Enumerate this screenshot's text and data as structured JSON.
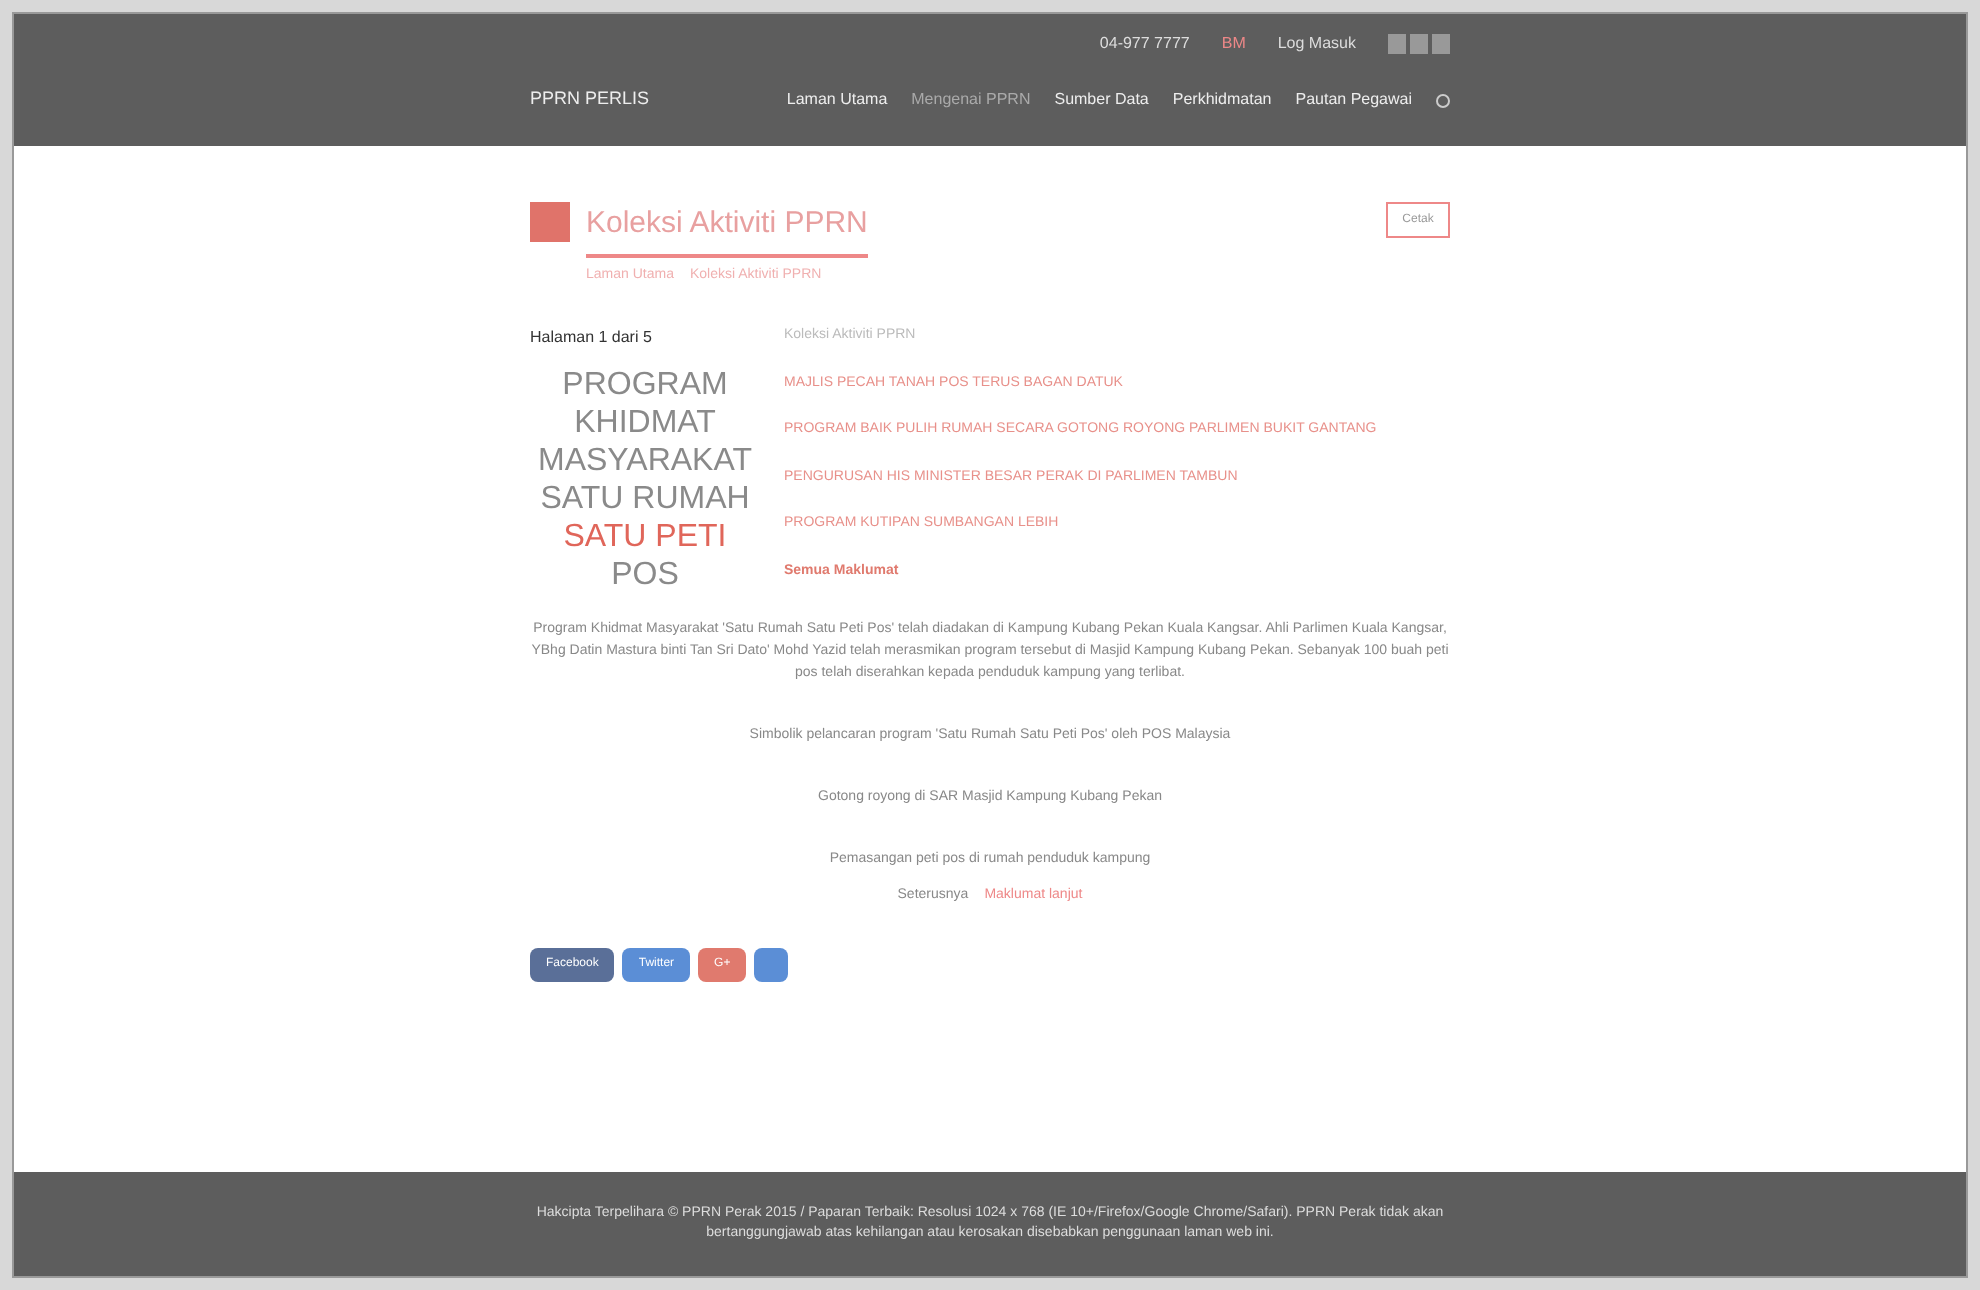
{
  "top_bar": {
    "phone": "04-977 7777",
    "language": "BM",
    "login": "Log Masuk"
  },
  "nav": {
    "brand": "PPRN PERLIS",
    "items": [
      {
        "label": "Laman Utama",
        "selected": false
      },
      {
        "label": "Mengenai PPRN",
        "selected": true
      },
      {
        "label": "Sumber Data",
        "selected": false
      },
      {
        "label": "Perkhidmatan",
        "selected": false
      },
      {
        "label": "Pautan Pegawai",
        "selected": false
      }
    ]
  },
  "page": {
    "title": "Koleksi Aktiviti PPRN",
    "breadcrumb": [
      "Laman Utama",
      "Koleksi Aktiviti PPRN"
    ],
    "print": "Cetak",
    "page_info": "Halaman 1 dari 5"
  },
  "poster_lines": [
    {
      "text": "PROGRAM",
      "kind": "normal"
    },
    {
      "text": "KHIDMAT",
      "kind": "normal"
    },
    {
      "text": "MASYARAKAT",
      "kind": "normal"
    },
    {
      "text": "SATU RUMAH",
      "kind": "normal"
    },
    {
      "text": "SATU PETI",
      "kind": "accent"
    },
    {
      "text": "POS",
      "kind": "normal"
    }
  ],
  "related": {
    "heading": "Koleksi Aktiviti PPRN",
    "links": [
      {
        "text": "MAJLIS PECAH TANAH POS TERUS BAGAN DATUK",
        "kind": "link"
      },
      {
        "text": "PROGRAM BAIK PULIH RUMAH SECARA GOTONG ROYONG PARLIMEN BUKIT GANTANG",
        "kind": "link"
      },
      {
        "text": "PENGURUSAN HIS MINISTER BESAR PERAK DI PARLIMEN TAMBUN",
        "kind": "link"
      },
      {
        "text": "PROGRAM KUTIPAN SUMBANGAN LEBIH",
        "kind": "link"
      },
      {
        "text": "Semua Maklumat",
        "kind": "more"
      }
    ]
  },
  "article": {
    "paragraphs": [
      "Program Khidmat Masyarakat 'Satu Rumah Satu Peti Pos' telah diadakan di Kampung Kubang Pekan Kuala Kangsar. Ahli Parlimen Kuala Kangsar, YBhg Datin Mastura binti Tan Sri Dato' Mohd Yazid telah merasmikan program tersebut di Masjid Kampung Kubang Pekan. Sebanyak 100 buah peti pos telah diserahkan kepada penduduk kampung yang terlibat.",
      "Simbolik pelancaran program 'Satu Rumah Satu Peti Pos' oleh POS Malaysia",
      "Gotong royong di SAR Masjid Kampung Kubang Pekan",
      "Pemasangan peti pos di rumah penduduk kampung"
    ],
    "more_prefix": "Seterusnya",
    "more_link": "Maklumat lanjut"
  },
  "share_buttons": [
    {
      "label": "Facebook",
      "kind": "facebook"
    },
    {
      "label": "Twitter",
      "kind": "twitter"
    },
    {
      "label": "G+",
      "kind": "google"
    },
    {
      "kind": "print"
    }
  ],
  "footer": "Hakcipta Terpelihara © PPRN Perak 2015 / Paparan Terbaik: Resolusi 1024 x 768 (IE 10+/Firefox/Google Chrome/Safari). PPRN Perak tidak akan bertanggungjawab atas kehilangan atau kerosakan disebabkan penggunaan laman web ini."
}
